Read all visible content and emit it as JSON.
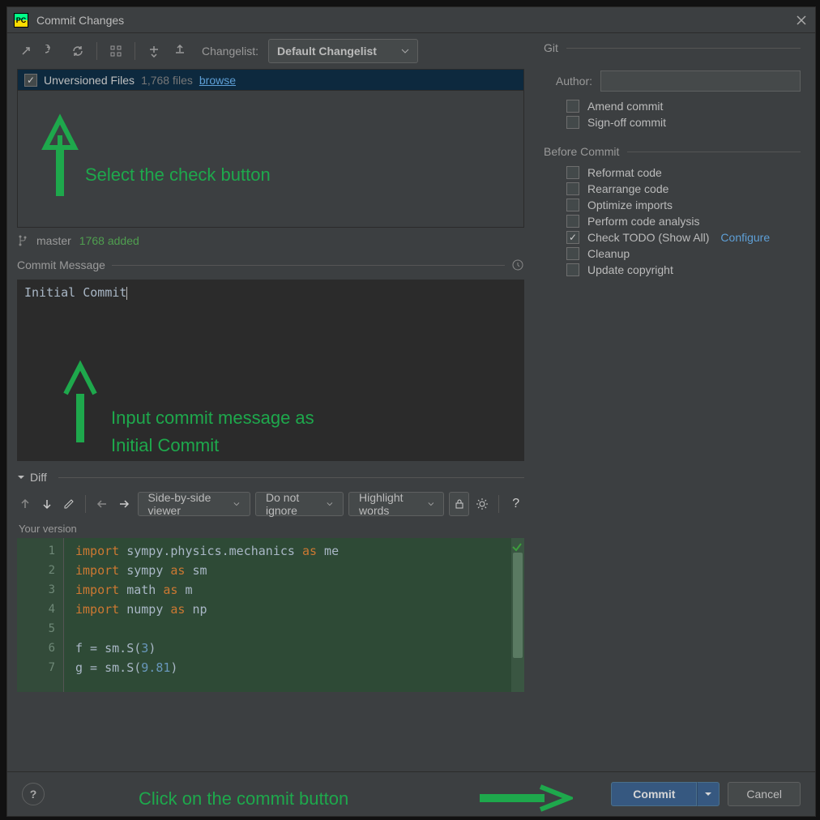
{
  "window": {
    "title": "Commit Changes"
  },
  "toolbar": {
    "changelist_label": "Changelist:",
    "changelist_value": "Default Changelist"
  },
  "filelist": {
    "row_label": "Unversioned Files",
    "row_count": "1,768 files",
    "browse_label": "browse"
  },
  "branch": {
    "name": "master",
    "added": "1768 added"
  },
  "commit_message": {
    "header": "Commit Message",
    "value": "Initial Commit"
  },
  "diff": {
    "header": "Diff",
    "viewer_mode": "Side-by-side viewer",
    "ignore_mode": "Do not ignore",
    "highlight_mode": "Highlight words",
    "your_version_label": "Your version"
  },
  "code": {
    "lines": [
      {
        "n": "1",
        "html": "<span class='kw'>import</span> sympy.physics.mechanics <span class='kw'>as</span> me"
      },
      {
        "n": "2",
        "html": "<span class='kw'>import</span> sympy <span class='kw'>as</span> sm"
      },
      {
        "n": "3",
        "html": "<span class='kw'>import</span> math <span class='kw'>as</span> m"
      },
      {
        "n": "4",
        "html": "<span class='kw'>import</span> numpy <span class='kw'>as</span> np"
      },
      {
        "n": "5",
        "html": ""
      },
      {
        "n": "6",
        "html": "f = sm.S(<span class='num'>3</span>)"
      },
      {
        "n": "7",
        "html": "g = sm.S(<span class='num'>9.81</span>)"
      }
    ]
  },
  "rightpanel": {
    "git_label": "Git",
    "author_label": "Author:",
    "author_value": "",
    "amend_label": "Amend commit",
    "signoff_label": "Sign-off commit",
    "before_commit_label": "Before Commit",
    "reformat_label": "Reformat code",
    "rearrange_label": "Rearrange code",
    "optimize_label": "Optimize imports",
    "analysis_label": "Perform code analysis",
    "todo_label": "Check TODO (Show All)",
    "configure_label": "Configure",
    "cleanup_label": "Cleanup",
    "copyright_label": "Update copyright"
  },
  "buttons": {
    "commit": "Commit",
    "cancel": "Cancel"
  },
  "annotations": {
    "a1": "Select the check button",
    "a2_line1": "Input commit message as",
    "a2_line2": "Initial Commit",
    "a3": "Click on the commit button"
  }
}
